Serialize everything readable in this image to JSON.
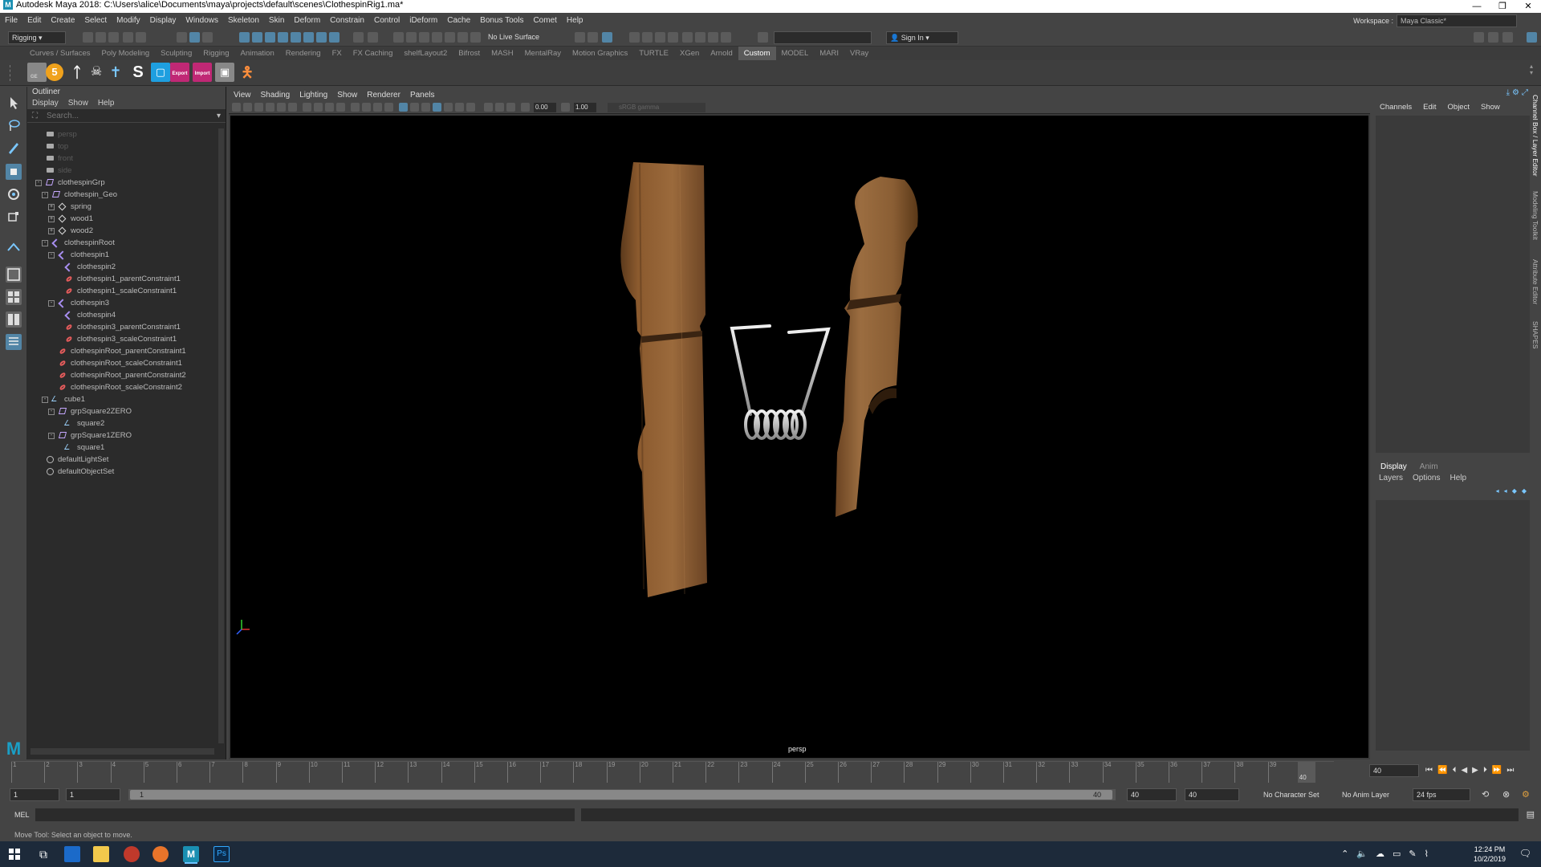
{
  "title": "Autodesk Maya 2018: C:\\Users\\alice\\Documents\\maya\\projects\\default\\scenes\\ClothespinRig1.ma*",
  "menus": [
    "File",
    "Edit",
    "Create",
    "Select",
    "Modify",
    "Display",
    "Windows",
    "Skeleton",
    "Skin",
    "Deform",
    "Constrain",
    "Control",
    "iDeform",
    "Cache",
    "Bonus Tools",
    "Comet",
    "Help"
  ],
  "workspace": {
    "label": "Workspace :",
    "value": "Maya Classic*"
  },
  "statusline": {
    "mode": "Rigging",
    "live_surface": "No Live Surface",
    "sign_in": "Sign In"
  },
  "shelf_tabs": [
    "Curves / Surfaces",
    "Poly Modeling",
    "Sculpting",
    "Rigging",
    "Animation",
    "Rendering",
    "FX",
    "FX Caching",
    "shelfLayout2",
    "Bifrost",
    "MASH",
    "MentalRay",
    "Motion Graphics",
    "TURTLE",
    "XGen",
    "Arnold",
    "Custom",
    "MODEL",
    "MARI",
    "VRay"
  ],
  "active_shelf": "Custom",
  "shelf_icons": {
    "s5": "5",
    "sS": "S",
    "export": "Export",
    "import": "Import",
    "ge": "GE"
  },
  "outliner": {
    "title": "Outliner",
    "menu": [
      "Display",
      "Show",
      "Help"
    ],
    "search_placeholder": "Search...",
    "items": [
      {
        "label": "persp",
        "type": "cam",
        "depth": 0,
        "dim": true
      },
      {
        "label": "top",
        "type": "cam",
        "depth": 0,
        "dim": true
      },
      {
        "label": "front",
        "type": "cam",
        "depth": 0,
        "dim": true
      },
      {
        "label": "side",
        "type": "cam",
        "depth": 0,
        "dim": true
      },
      {
        "label": "clothespinGrp",
        "type": "grp",
        "depth": 0,
        "exp": "-"
      },
      {
        "label": "clothespin_Geo",
        "type": "grp",
        "depth": 1,
        "exp": "-"
      },
      {
        "label": "spring",
        "type": "mesh",
        "depth": 2,
        "exp": "+"
      },
      {
        "label": "wood1",
        "type": "mesh",
        "depth": 2,
        "exp": "+"
      },
      {
        "label": "wood2",
        "type": "mesh",
        "depth": 2,
        "exp": "+"
      },
      {
        "label": "clothespinRoot",
        "type": "joint",
        "depth": 1,
        "exp": "-"
      },
      {
        "label": "clothespin1",
        "type": "joint",
        "depth": 2,
        "exp": "-"
      },
      {
        "label": "clothespin2",
        "type": "joint",
        "depth": 3
      },
      {
        "label": "clothespin1_parentConstraint1",
        "type": "cons",
        "depth": 3
      },
      {
        "label": "clothespin1_scaleConstraint1",
        "type": "cons",
        "depth": 3
      },
      {
        "label": "clothespin3",
        "type": "joint",
        "depth": 2,
        "exp": "-"
      },
      {
        "label": "clothespin4",
        "type": "joint",
        "depth": 3
      },
      {
        "label": "clothespin3_parentConstraint1",
        "type": "cons",
        "depth": 3
      },
      {
        "label": "clothespin3_scaleConstraint1",
        "type": "cons",
        "depth": 3
      },
      {
        "label": "clothespinRoot_parentConstraint1",
        "type": "cons",
        "depth": 2
      },
      {
        "label": "clothespinRoot_scaleConstraint1",
        "type": "cons",
        "depth": 2
      },
      {
        "label": "clothespinRoot_parentConstraint2",
        "type": "cons",
        "depth": 2
      },
      {
        "label": "clothespinRoot_scaleConstraint2",
        "type": "cons",
        "depth": 2
      },
      {
        "label": "cube1",
        "type": "curve",
        "depth": 1,
        "exp": "-"
      },
      {
        "label": "grpSquare2ZERO",
        "type": "grp",
        "depth": 2,
        "exp": "-"
      },
      {
        "label": "square2",
        "type": "curve",
        "depth": 3
      },
      {
        "label": "grpSquare1ZERO",
        "type": "grp",
        "depth": 2,
        "exp": "-"
      },
      {
        "label": "square1",
        "type": "curve",
        "depth": 3
      },
      {
        "label": "defaultLightSet",
        "type": "set",
        "depth": 0
      },
      {
        "label": "defaultObjectSet",
        "type": "set",
        "depth": 0
      }
    ]
  },
  "viewport": {
    "menu": [
      "View",
      "Shading",
      "Lighting",
      "Show",
      "Renderer",
      "Panels"
    ],
    "field1": "0.00",
    "field2": "1.00",
    "gamma": "sRGB gamma",
    "camera": "persp"
  },
  "channel_box": {
    "menu": [
      "Channels",
      "Edit",
      "Object",
      "Show"
    ]
  },
  "layer_editor": {
    "tabs": [
      "Display",
      "Anim"
    ],
    "active_tab": "Display",
    "menu": [
      "Layers",
      "Options",
      "Help"
    ]
  },
  "side_tabs": [
    "Channel Box / Layer Editor",
    "Modeling Toolkit",
    "Attribute Editor",
    "SHAPES"
  ],
  "timeline": {
    "start": 1,
    "end": 40,
    "current": 40,
    "current_label": "40",
    "current_field": "40",
    "range_start": "1",
    "range_start2": "1",
    "range_slider_start": "1",
    "range_slider_end": "40",
    "range_end": "40",
    "range_end2": "40",
    "char_set": "No Character Set",
    "anim_layer": "No Anim Layer",
    "fps": "24 fps"
  },
  "command": {
    "lang": "MEL"
  },
  "help_line": "Move Tool: Select an object to move.",
  "taskbar": {
    "time": "12:24 PM",
    "date": "10/2/2019"
  },
  "colors": {
    "accent": "#5285a6",
    "wood": "#8b5a2b",
    "viewport_bg": "#000000"
  }
}
